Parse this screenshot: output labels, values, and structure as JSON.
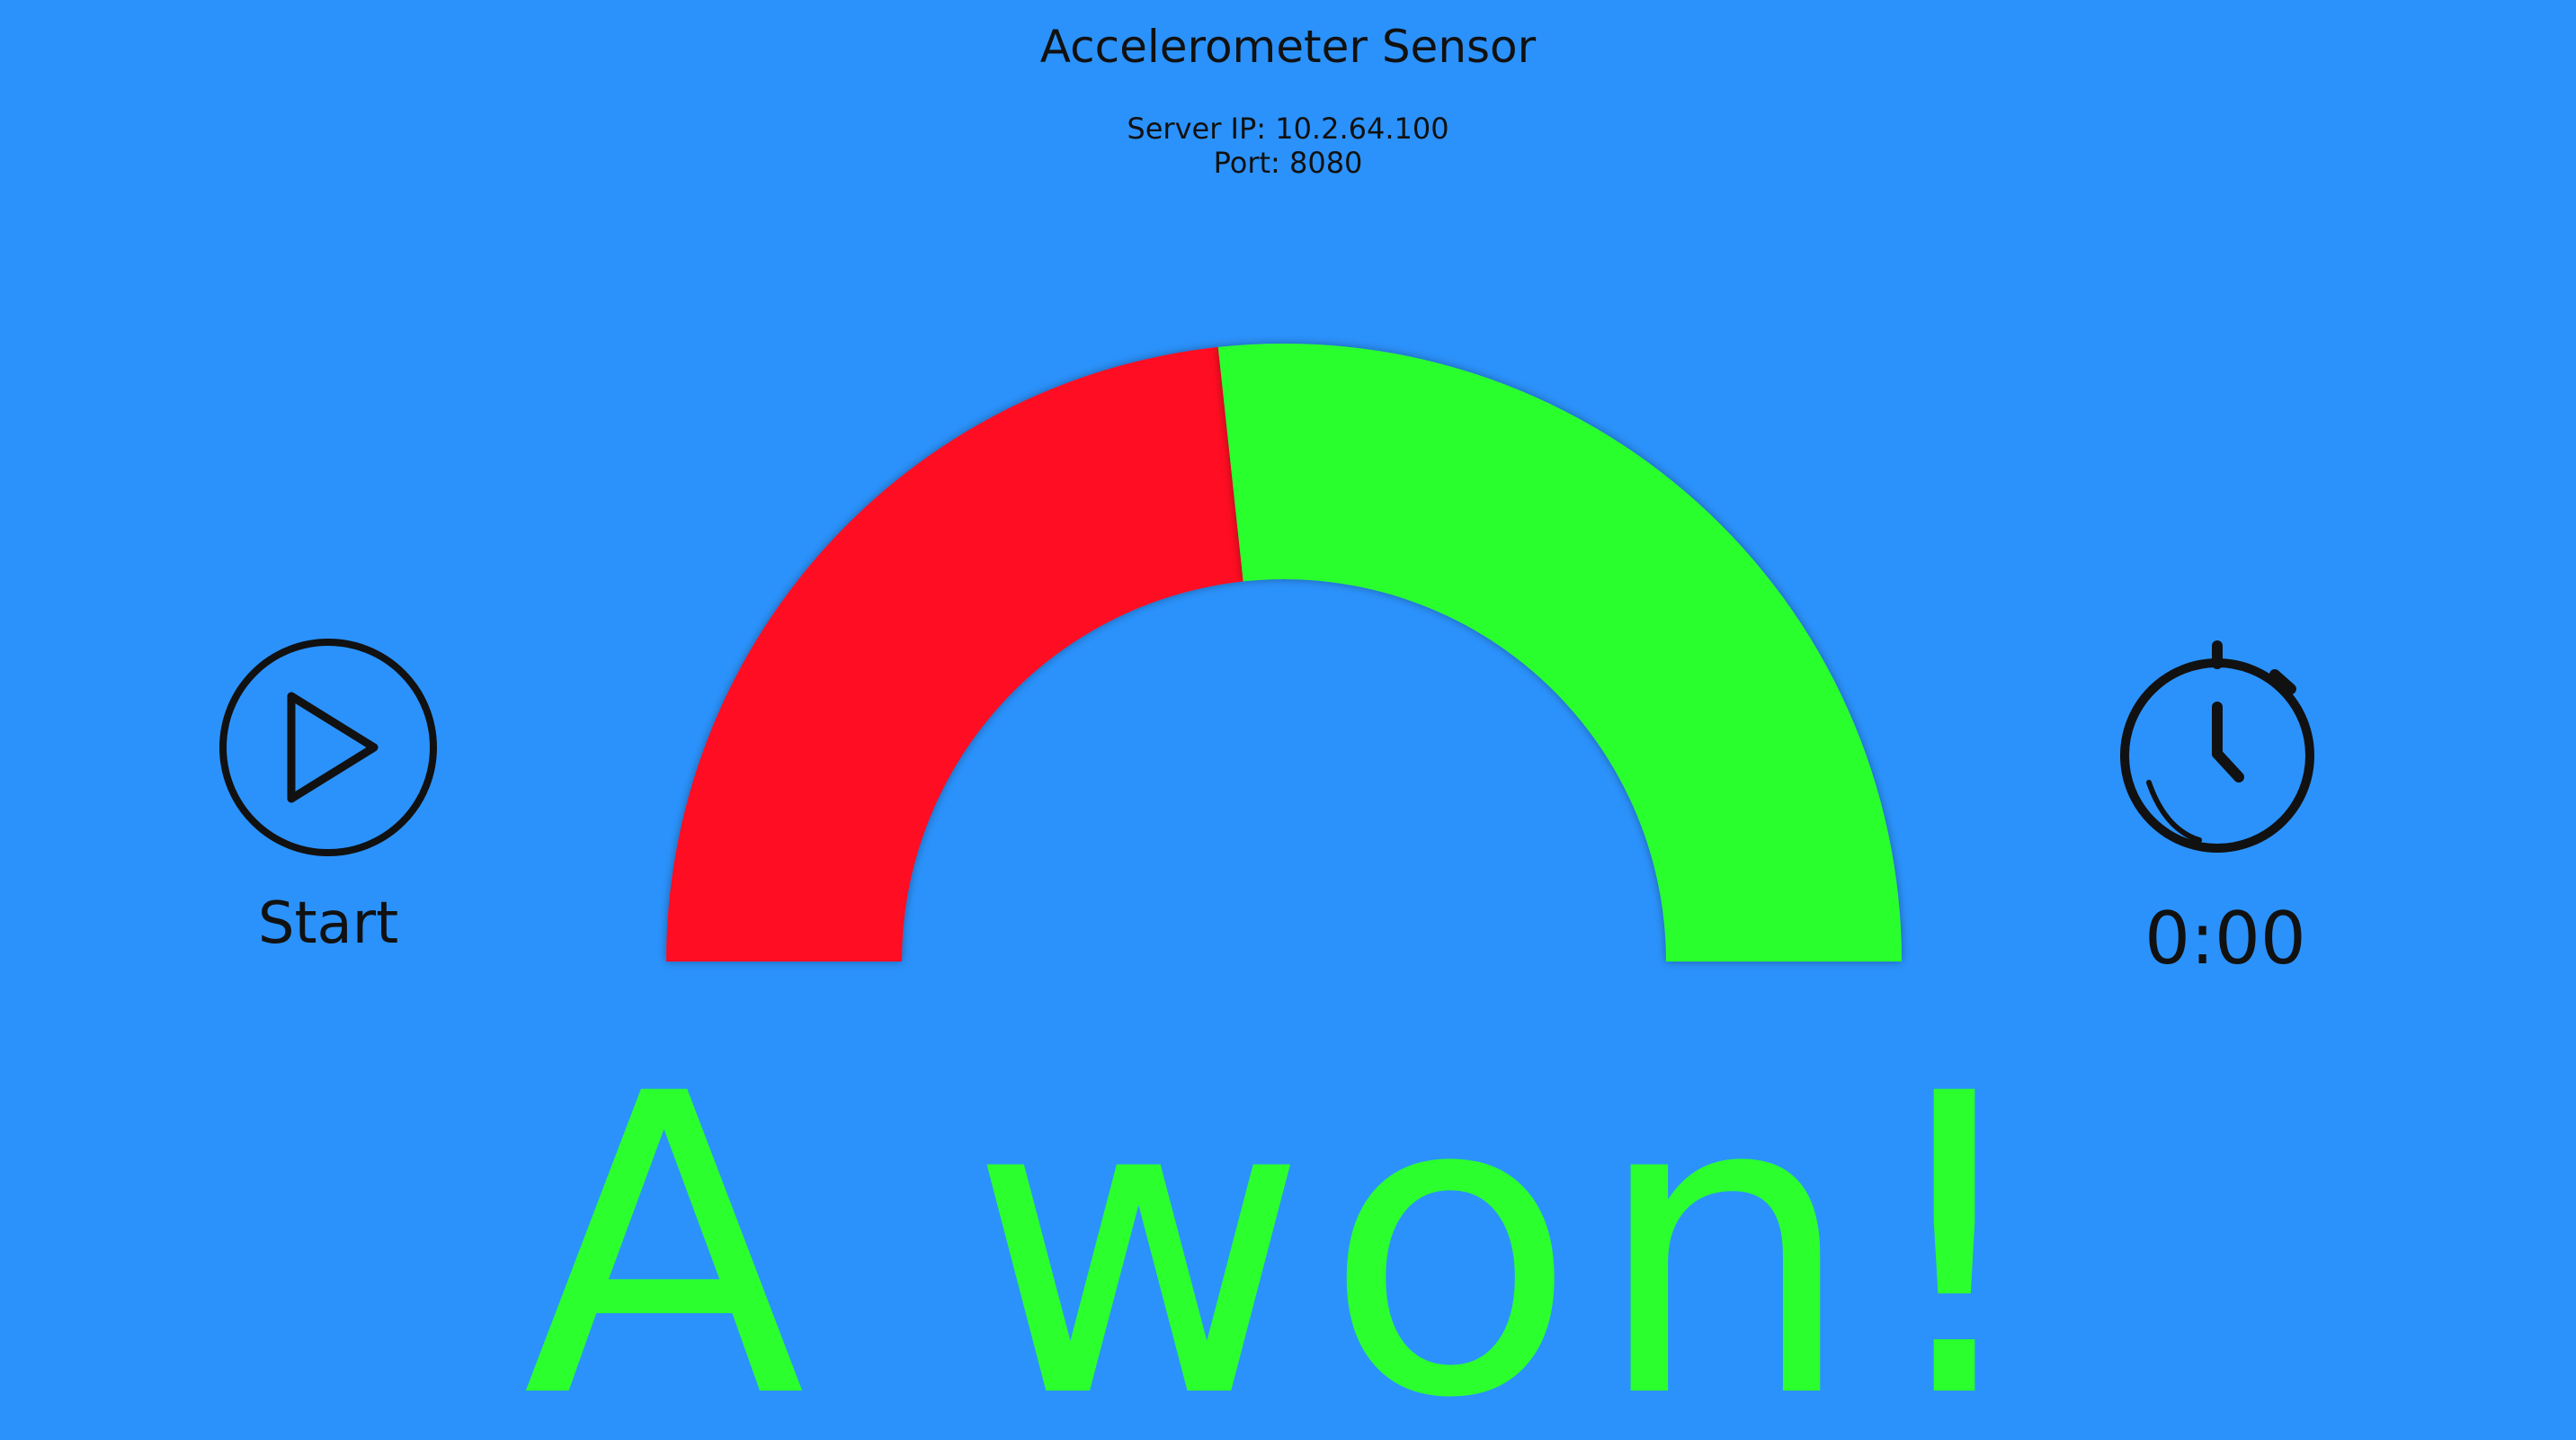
{
  "app": {
    "title": "Accelerometer Sensor",
    "server_ip_label": "Server IP: 10.2.64.100",
    "port_label": "Port: 8080"
  },
  "controls": {
    "start_label": "Start",
    "timer_value": "0:00",
    "start_icon": "play-circle-icon",
    "timer_icon": "stopwatch-icon"
  },
  "gauge": {
    "red_share": 0.466,
    "green_share": 0.534,
    "colors": {
      "background": "#2b92fc",
      "red": "#ff0e20",
      "green": "#2bff2e",
      "text": "#111111"
    }
  },
  "result": {
    "message": "A won!"
  }
}
